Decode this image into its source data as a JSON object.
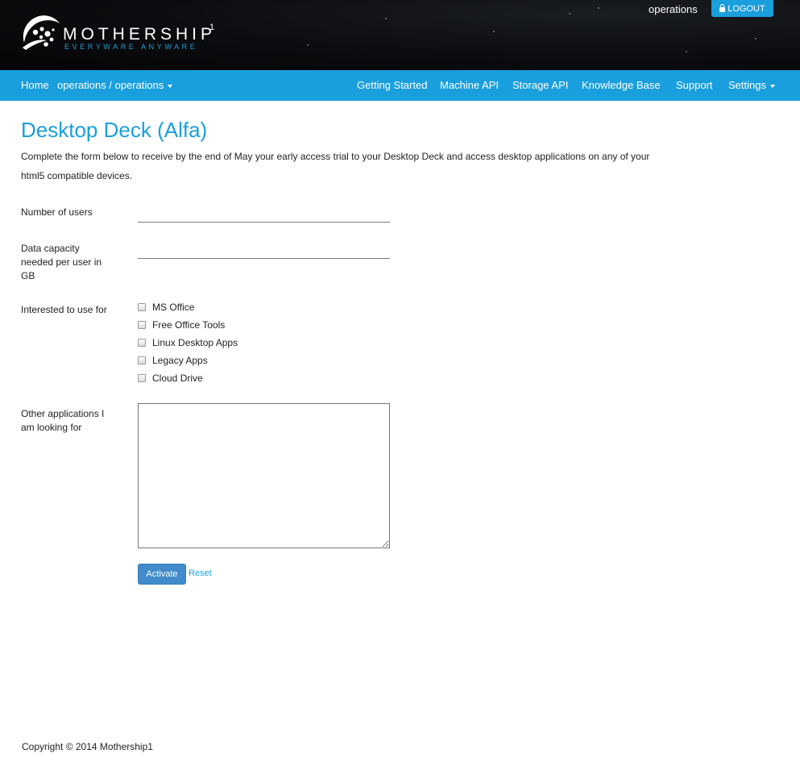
{
  "header": {
    "logo_text": "MOTHERSHIP",
    "logo_superscript": "1",
    "logo_tagline": "EVERYWARE ANYWARE",
    "user_name": "operations",
    "logout_label": "LOGOUT"
  },
  "nav": {
    "home": "Home",
    "context": "operations / operations",
    "getting_started": "Getting Started",
    "machine_api": "Machine API",
    "storage_api": "Storage API",
    "knowledge_base": "Knowledge Base",
    "support": "Support",
    "settings": "Settings"
  },
  "page": {
    "title": "Desktop Deck (Alfa)",
    "intro": "Complete the form below to receive by the end of May your early access trial to your Desktop Deck and access desktop applications on any of your html5 compatible devices."
  },
  "form": {
    "users_label": "Number of users",
    "users_value": "",
    "capacity_label": "Data capacity needed per user in GB",
    "capacity_value": "",
    "use_label": "Interested to use for",
    "options": [
      {
        "label": "MS Office",
        "checked": false
      },
      {
        "label": "Free Office Tools",
        "checked": false
      },
      {
        "label": "Linux Desktop Apps",
        "checked": false
      },
      {
        "label": "Legacy Apps",
        "checked": false
      },
      {
        "label": "Cloud Drive",
        "checked": false
      }
    ],
    "other_label": "Other applications I am looking for",
    "other_value": "",
    "activate_label": "Activate",
    "reset_label": "Reset"
  },
  "footer": {
    "copyright": "Copyright © 2014 Mothership1"
  },
  "colors": {
    "brand_blue": "#1a9fde",
    "button_blue": "#428bca",
    "header_dark": "#0b0c0f"
  }
}
